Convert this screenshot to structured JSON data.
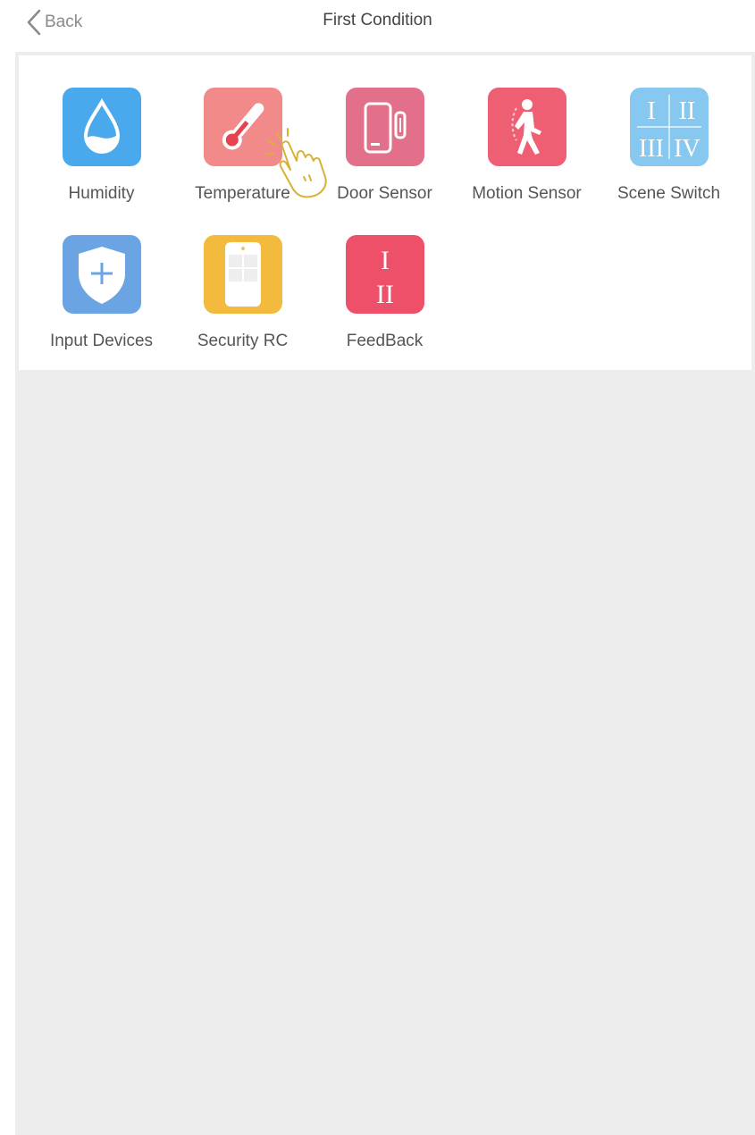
{
  "header": {
    "back_label": "Back",
    "title": "First Condition"
  },
  "colors": {
    "humidity": "#4aa9ec",
    "temperature": "#f28a8a",
    "door_sensor": "#e3708a",
    "motion_sensor": "#ee5f73",
    "scene_switch": "#86c8f0",
    "input_devices": "#6aa4e3",
    "security_rc": "#f3bb3e",
    "feedback": "#ee4f69",
    "background_panel": "#ededed"
  },
  "tiles": [
    {
      "label": "Humidity",
      "icon": "water-drop-icon"
    },
    {
      "label": "Temperature",
      "icon": "thermometer-icon"
    },
    {
      "label": "Door Sensor",
      "icon": "door-sensor-icon"
    },
    {
      "label": "Motion Sensor",
      "icon": "walking-person-icon"
    },
    {
      "label": "Scene Switch",
      "icon": "roman-numerals-grid-icon",
      "glyphs": [
        "I",
        "II",
        "III",
        "IV"
      ]
    },
    {
      "label": "Input Devices",
      "icon": "shield-plus-icon"
    },
    {
      "label": "Security RC",
      "icon": "remote-control-icon"
    },
    {
      "label": "FeedBack",
      "icon": "roman-numerals-icon",
      "glyphs": [
        "I",
        "II"
      ]
    }
  ]
}
